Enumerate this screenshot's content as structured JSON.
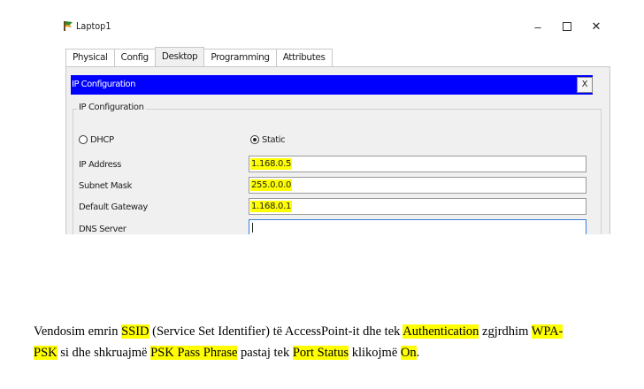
{
  "window": {
    "title": "Laptop1",
    "controls": {
      "minimize": "–",
      "close": "✕"
    }
  },
  "tabs": [
    {
      "label": "Physical",
      "active": false
    },
    {
      "label": "Config",
      "active": false
    },
    {
      "label": "Desktop",
      "active": true
    },
    {
      "label": "Programming",
      "active": false
    },
    {
      "label": "Attributes",
      "active": false
    }
  ],
  "ip_config": {
    "bar_title": "IP Configuration",
    "close_label": "X",
    "group_label": "IP Configuration",
    "dhcp_label": "DHCP",
    "static_label": "Static",
    "selected_mode": "Static",
    "fields": {
      "ip_address": {
        "label": "IP Address",
        "value": "1.168.0.5"
      },
      "subnet_mask": {
        "label": "Subnet Mask",
        "value": "255.0.0.0"
      },
      "default_gateway": {
        "label": "Default Gateway",
        "value": "1.168.0.1"
      },
      "dns_server": {
        "label": "DNS Server",
        "value": ""
      }
    }
  },
  "instruction": {
    "t1": "Vendosim emrin ",
    "h1": "SSID",
    "t2": " (Service Set Identifier) të AccessPoint-it dhe tek ",
    "h2": "Authentication",
    "t3": " zgjrdhim ",
    "h3a": "WPA-",
    "h3b": "PSK",
    "t4": " si dhe shkruajmë ",
    "h4": "PSK Pass Phrase",
    "t5": " pastaj tek ",
    "h5": "Port Status",
    "t6": " klikojmë ",
    "h6": "On",
    "t7": "."
  },
  "colors": {
    "title_bar_blue": "#0000ff",
    "highlight_yellow": "#ffff00"
  }
}
